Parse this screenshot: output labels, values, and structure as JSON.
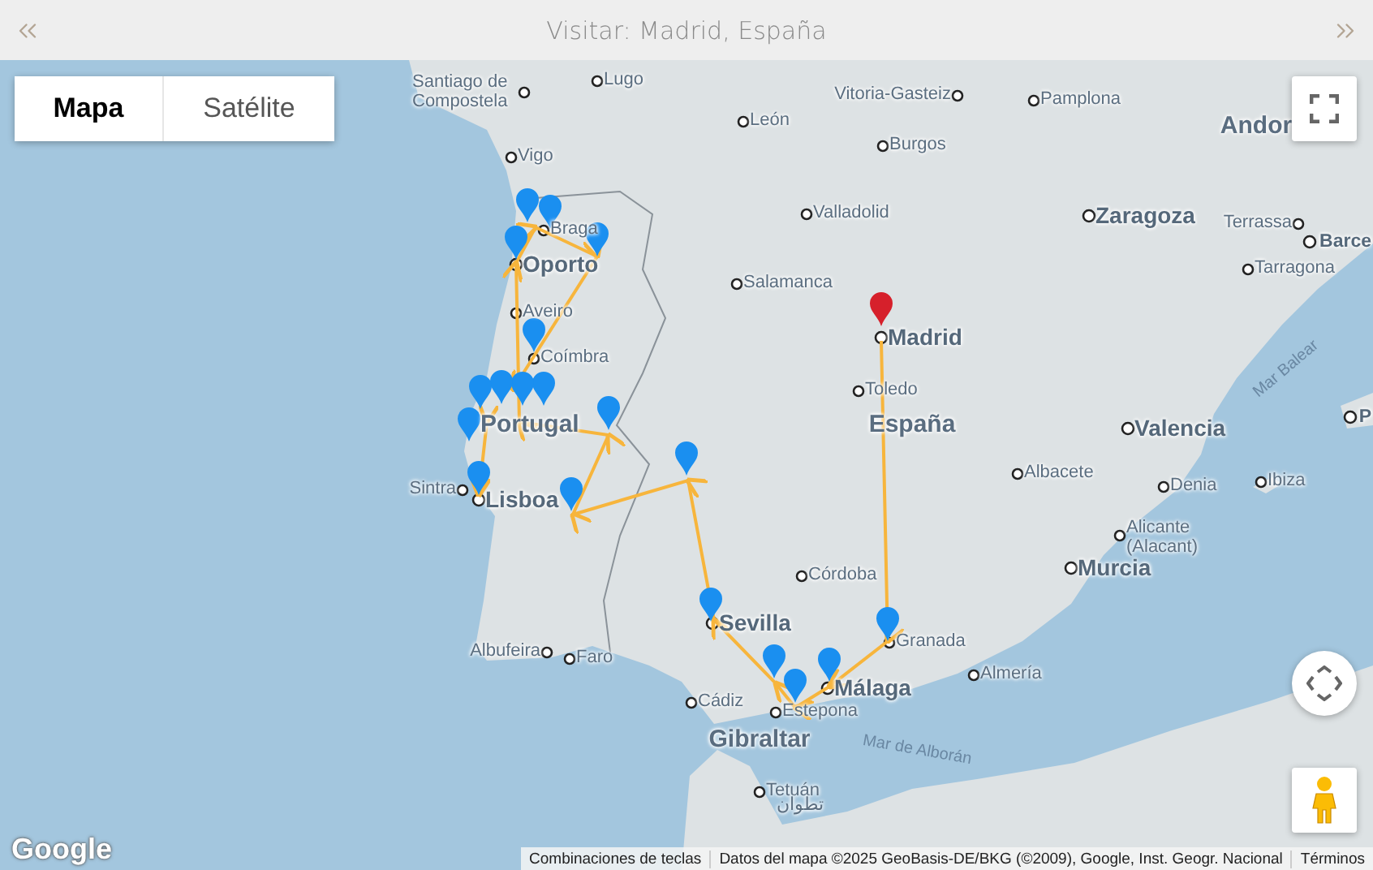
{
  "header": {
    "title": "Visitar: Madrid, España"
  },
  "map_type_tabs": [
    {
      "label": "Mapa",
      "selected": true
    },
    {
      "label": "Satélite",
      "selected": false
    }
  ],
  "places": [
    {
      "name": "Lugo",
      "kind": "city"
    },
    {
      "name": "Santiago de Compostela",
      "kind": "city"
    },
    {
      "name": "Vitoria-Gasteiz",
      "kind": "city"
    },
    {
      "name": "Pamplona",
      "kind": "city"
    },
    {
      "name": "León",
      "kind": "city"
    },
    {
      "name": "Andor",
      "kind": "country"
    },
    {
      "name": "Burgos",
      "kind": "city"
    },
    {
      "name": "Vigo",
      "kind": "city"
    },
    {
      "name": "Valladolid",
      "kind": "city"
    },
    {
      "name": "Zaragoza",
      "kind": "major"
    },
    {
      "name": "Terrassa",
      "kind": "city"
    },
    {
      "name": "Braga",
      "kind": "city"
    },
    {
      "name": "Barce",
      "kind": "major"
    },
    {
      "name": "Oporto",
      "kind": "major"
    },
    {
      "name": "Tarragona",
      "kind": "city"
    },
    {
      "name": "Salamanca",
      "kind": "city"
    },
    {
      "name": "Aveiro",
      "kind": "city"
    },
    {
      "name": "Madrid",
      "kind": "major"
    },
    {
      "name": "Coímbra",
      "kind": "city"
    },
    {
      "name": "Mar Balear",
      "kind": "sea"
    },
    {
      "name": "Toledo",
      "kind": "city"
    },
    {
      "name": "Portugal",
      "kind": "country"
    },
    {
      "name": "España",
      "kind": "country"
    },
    {
      "name": "Valencia",
      "kind": "major"
    },
    {
      "name": "P",
      "kind": "major"
    },
    {
      "name": "Albacete",
      "kind": "city"
    },
    {
      "name": "Denia",
      "kind": "city"
    },
    {
      "name": "Ibiza",
      "kind": "city"
    },
    {
      "name": "Sintra",
      "kind": "city"
    },
    {
      "name": "Lisboa",
      "kind": "major"
    },
    {
      "name": "Alicante (Alacant)",
      "kind": "city"
    },
    {
      "name": "Murcia",
      "kind": "major"
    },
    {
      "name": "Córdoba",
      "kind": "city"
    },
    {
      "name": "Sevilla",
      "kind": "major"
    },
    {
      "name": "Granada",
      "kind": "city"
    },
    {
      "name": "Albufeira",
      "kind": "city"
    },
    {
      "name": "Faro",
      "kind": "city"
    },
    {
      "name": "Almería",
      "kind": "city"
    },
    {
      "name": "Málaga",
      "kind": "major"
    },
    {
      "name": "Cádiz",
      "kind": "city"
    },
    {
      "name": "Estepona",
      "kind": "city"
    },
    {
      "name": "Gibraltar",
      "kind": "country"
    },
    {
      "name": "Mar de Alborán",
      "kind": "sea"
    },
    {
      "name": "Tetuán",
      "kind": "city"
    },
    {
      "name": "تطوان",
      "kind": "city"
    }
  ],
  "markers": [
    {
      "selected": true
    },
    {
      "selected": false
    },
    {
      "selected": false
    },
    {
      "selected": false
    },
    {
      "selected": false
    },
    {
      "selected": false
    },
    {
      "selected": false
    },
    {
      "selected": false
    },
    {
      "selected": false
    },
    {
      "selected": false
    },
    {
      "selected": false
    },
    {
      "selected": false
    },
    {
      "selected": false
    },
    {
      "selected": false
    },
    {
      "selected": false
    },
    {
      "selected": false
    },
    {
      "selected": false
    },
    {
      "selected": false
    },
    {
      "selected": false
    },
    {
      "selected": false
    }
  ],
  "logo": "Google",
  "attribution": [
    "Combinaciones de teclas",
    "Datos del mapa ©2025 GeoBasis-DE/BKG (©2009), Google, Inst. Geogr. Nacional",
    "Términos"
  ]
}
